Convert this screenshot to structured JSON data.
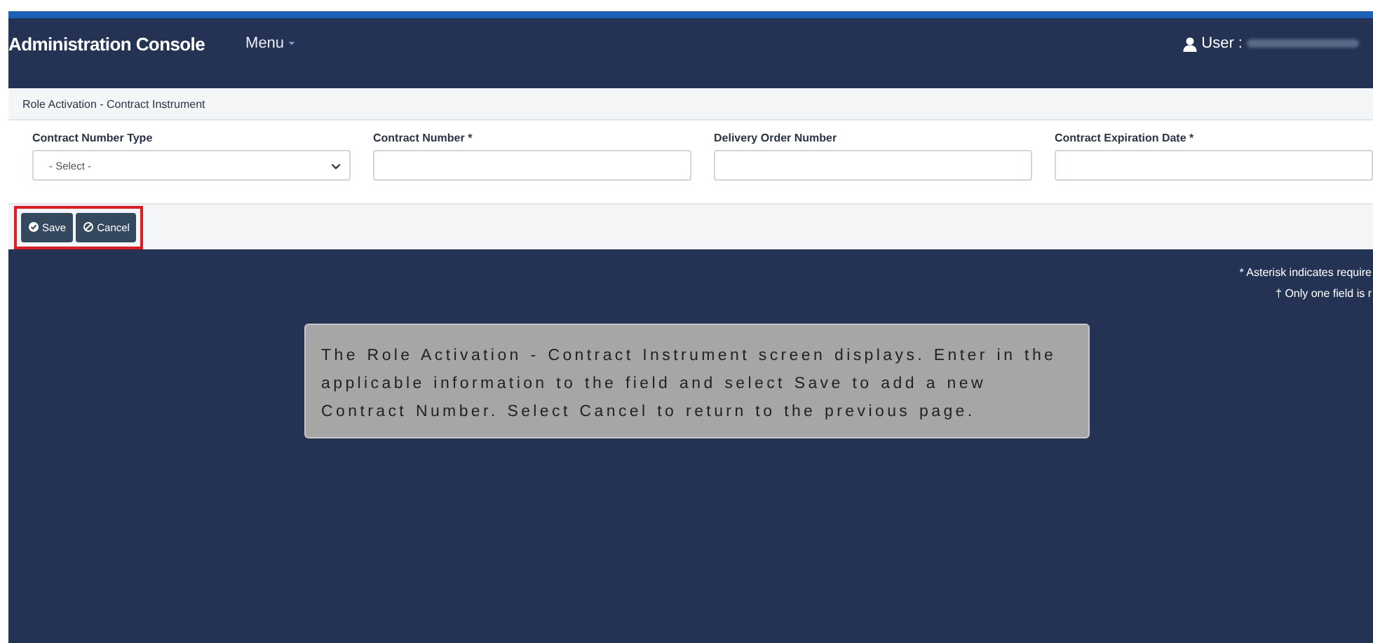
{
  "navbar": {
    "title": "Administration Console",
    "menu": "Menu",
    "user_label": "User :"
  },
  "panel": {
    "title": "Role Activation - Contract Instrument",
    "fields": [
      {
        "kind": "select",
        "label": "Contract Number Type",
        "placeholder": "- Select -"
      },
      {
        "kind": "text",
        "label": "Contract Number *"
      },
      {
        "kind": "text",
        "label": "Delivery Order Number"
      },
      {
        "kind": "text",
        "label": "Contract Expiration Date *"
      }
    ],
    "buttons": [
      {
        "kind": "save",
        "label": "Save"
      },
      {
        "kind": "cancel",
        "label": "Cancel"
      }
    ]
  },
  "notes": [
    "* Asterisk indicates require",
    "† Only one field is r"
  ],
  "callout": "The Role Activation - Contract Instrument screen displays. Enter in the applicable information to the field and select Save to add a new Contract Number. Select Cancel to return to the previous page."
}
